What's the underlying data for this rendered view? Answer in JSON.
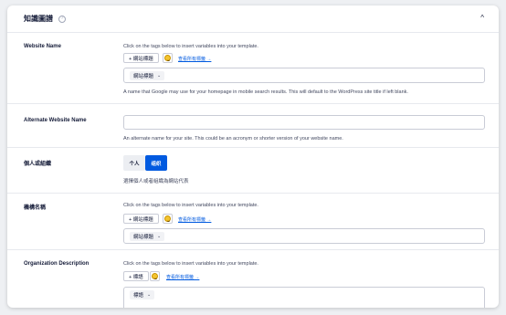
{
  "panel": {
    "title": "知識圖譜",
    "help_icon": "?",
    "collapse_icon": "^"
  },
  "website_name": {
    "label": "Website Name",
    "instructions": "Click on the tags below to insert variables into your template.",
    "add_tag_label": "+ 網站標題",
    "view_all_tags": "查看所有標籤 →",
    "editor_chip": "網站標題",
    "help_text": "A name that Google may use for your homepage in mobile search results. This will default to the WordPress site title if left blank."
  },
  "alternate_name": {
    "label": "Alternate Website Name",
    "value": "",
    "help_text": "An alternate name for your site. This could be an acronym or shorter version of your website name."
  },
  "person_or_org": {
    "label": "個人或組織",
    "options": [
      "个人",
      "组织"
    ],
    "selected": "组织",
    "help_text": "選擇個人或者組織為網站代表"
  },
  "organization_name": {
    "label": "機構名稱",
    "instructions": "Click on the tags below to insert variables into your template.",
    "add_tag_label": "+ 網站標題",
    "view_all_tags": "查看所有標籤 →",
    "editor_chip": "網站標題"
  },
  "organization_description": {
    "label": "Organization Description",
    "instructions": "Click on the tags below to insert variables into your template.",
    "add_tag_label": "+ 標語",
    "view_all_tags": "查看所有標籤 →",
    "editor_chip": "標語"
  },
  "icons": {
    "chip_chevron": "⌄"
  },
  "colors": {
    "accent": "#005ae0",
    "text": "#141b38",
    "muted": "#434960",
    "border": "#e7e9ee"
  }
}
